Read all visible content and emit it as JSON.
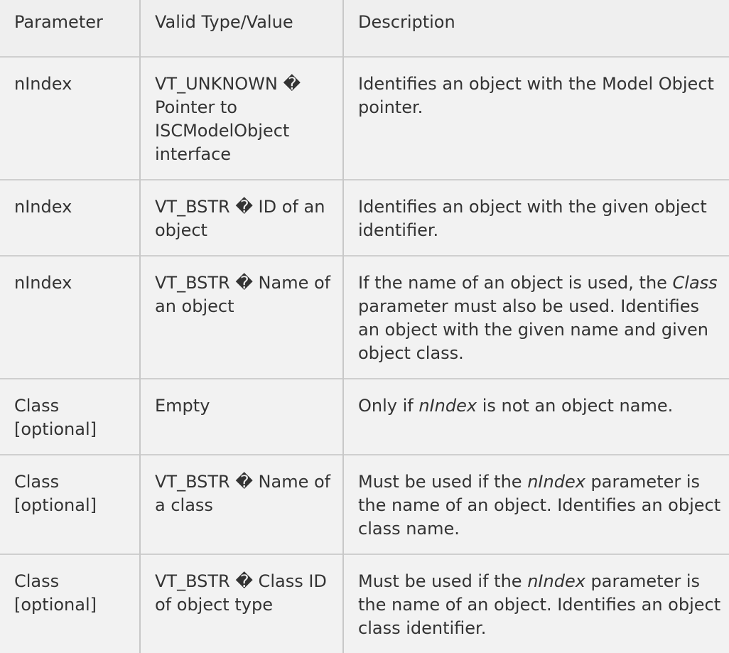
{
  "table": {
    "headers": [
      "Parameter",
      "Valid Type/Value",
      "Description"
    ],
    "rows": [
      {
        "parameter": "nIndex",
        "type": "VT_UNKNOWN � Pointer to ISCModelObject interface",
        "description": [
          {
            "text": "Identifies an object with the Model Object pointer.",
            "italic": false
          }
        ]
      },
      {
        "parameter": "nIndex",
        "type": "VT_BSTR � ID of an object",
        "description": [
          {
            "text": "Identifies an object with the given object identifier.",
            "italic": false
          }
        ]
      },
      {
        "parameter": "nIndex",
        "type": "VT_BSTR � Name of an object",
        "description": [
          {
            "text": "If the name of an object is used, the ",
            "italic": false
          },
          {
            "text": "Class",
            "italic": true
          },
          {
            "text": " parameter must also be used. Identifies an object with the given name and given object class.",
            "italic": false
          }
        ]
      },
      {
        "parameter": "Class [optional]",
        "type": "Empty",
        "description": [
          {
            "text": "Only if ",
            "italic": false
          },
          {
            "text": "nIndex",
            "italic": true
          },
          {
            "text": " is not an object name.",
            "italic": false
          }
        ]
      },
      {
        "parameter": "Class [optional]",
        "type": "VT_BSTR � Name of a class",
        "description": [
          {
            "text": "Must be used if the ",
            "italic": false
          },
          {
            "text": "nIndex",
            "italic": true
          },
          {
            "text": " parameter is the name of an object. Identifies an object class name.",
            "italic": false
          }
        ]
      },
      {
        "parameter": "Class [optional]",
        "type": "VT_BSTR � Class ID of object type",
        "description": [
          {
            "text": "Must be used if the ",
            "italic": false
          },
          {
            "text": "nIndex",
            "italic": true
          },
          {
            "text": " parameter is the name of an object. Identifies an object class identifier.",
            "italic": false
          }
        ]
      }
    ]
  }
}
